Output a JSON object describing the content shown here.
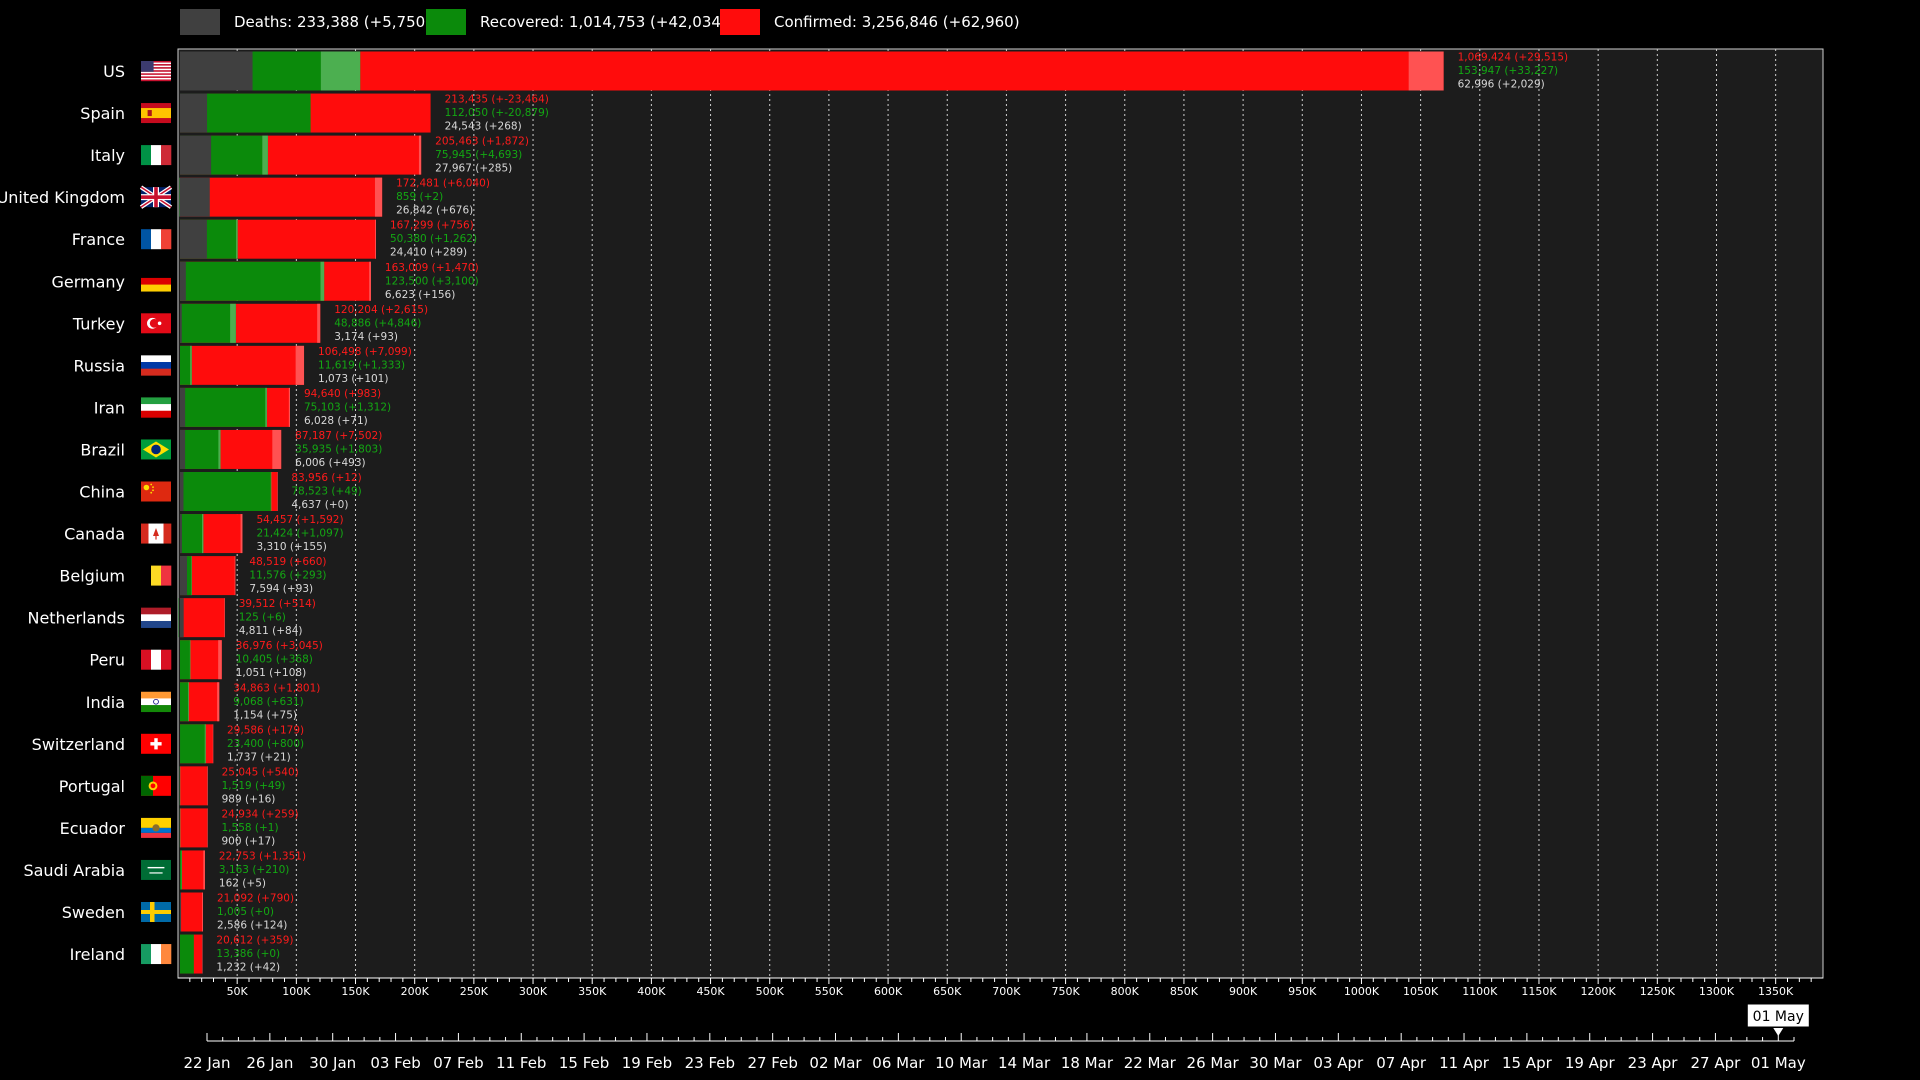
{
  "legend": [
    {
      "key": "deaths",
      "label": "Deaths: 233,388 (+5,750)",
      "color": "#404040"
    },
    {
      "key": "recovered",
      "label": "Recovered: 1,014,753 (+42,034)",
      "color": "#0b8a0b"
    },
    {
      "key": "confirmed",
      "label": "Confirmed: 3,256,846 (+62,960)",
      "color": "#ff0c0c"
    }
  ],
  "colors": {
    "background": "#000000",
    "plot_background": "#1c1c1c",
    "deaths": "#404040",
    "recovered": "#0b8a0b",
    "confirmed": "#ff0c0c",
    "confirmed_increment": "#ff5252",
    "recovered_increment": "#4caf50"
  },
  "chart_data": {
    "type": "bar",
    "orientation": "horizontal",
    "stacked_overlay": true,
    "xlim": [
      0,
      1390000
    ],
    "x_ticks": [
      50000,
      100000,
      150000,
      200000,
      250000,
      300000,
      350000,
      400000,
      450000,
      500000,
      550000,
      600000,
      650000,
      700000,
      750000,
      800000,
      850000,
      900000,
      950000,
      1000000,
      1050000,
      1100000,
      1150000,
      1200000,
      1250000,
      1300000,
      1350000
    ],
    "x_tick_labels": [
      "50K",
      "100K",
      "150K",
      "200K",
      "250K",
      "300K",
      "350K",
      "400K",
      "450K",
      "500K",
      "550K",
      "600K",
      "650K",
      "700K",
      "750K",
      "800K",
      "850K",
      "900K",
      "950K",
      "1000K",
      "1050K",
      "1100K",
      "1150K",
      "1200K",
      "1250K",
      "1300K",
      "1350K"
    ],
    "grid": true,
    "legend_position": "top-left",
    "countries": [
      {
        "name": "US",
        "flag": "us",
        "confirmed": 1069424,
        "confirmed_delta": 29515,
        "recovered": 153947,
        "recovered_delta": 33227,
        "deaths": 62996,
        "deaths_delta": 2029,
        "confirmed_label": "1,069,424 (+29,515)",
        "recovered_label": "153,947 (+33,227)",
        "deaths_label": "62,996 (+2,029)"
      },
      {
        "name": "Spain",
        "flag": "es",
        "confirmed": 213435,
        "confirmed_delta": -23464,
        "recovered": 112050,
        "recovered_delta": -20879,
        "deaths": 24543,
        "deaths_delta": 268,
        "confirmed_label": "213,435 (+-23,464)",
        "recovered_label": "112,050 (+-20,879)",
        "deaths_label": "24,543 (+268)"
      },
      {
        "name": "Italy",
        "flag": "it",
        "confirmed": 205463,
        "confirmed_delta": 1872,
        "recovered": 75945,
        "recovered_delta": 4693,
        "deaths": 27967,
        "deaths_delta": 285,
        "confirmed_label": "205,463 (+1,872)",
        "recovered_label": "75,945 (+4,693)",
        "deaths_label": "27,967 (+285)"
      },
      {
        "name": "United Kingdom",
        "flag": "gb",
        "confirmed": 172481,
        "confirmed_delta": 6040,
        "recovered": 859,
        "recovered_delta": 2,
        "deaths": 26842,
        "deaths_delta": 676,
        "confirmed_label": "172,481 (+6,040)",
        "recovered_label": "859 (+2)",
        "deaths_label": "26,842 (+676)"
      },
      {
        "name": "France",
        "flag": "fr",
        "confirmed": 167299,
        "confirmed_delta": 756,
        "recovered": 50380,
        "recovered_delta": 1262,
        "deaths": 24410,
        "deaths_delta": 289,
        "confirmed_label": "167,299 (+756)",
        "recovered_label": "50,380 (+1,262)",
        "deaths_label": "24,410 (+289)"
      },
      {
        "name": "Germany",
        "flag": "de",
        "confirmed": 163009,
        "confirmed_delta": 1470,
        "recovered": 123500,
        "recovered_delta": 3100,
        "deaths": 6623,
        "deaths_delta": 156,
        "confirmed_label": "163,009 (+1,470)",
        "recovered_label": "123,500 (+3,100)",
        "deaths_label": "6,623 (+156)"
      },
      {
        "name": "Turkey",
        "flag": "tr",
        "confirmed": 120204,
        "confirmed_delta": 2615,
        "recovered": 48886,
        "recovered_delta": 4846,
        "deaths": 3174,
        "deaths_delta": 93,
        "confirmed_label": "120,204 (+2,615)",
        "recovered_label": "48,886 (+4,846)",
        "deaths_label": "3,174 (+93)"
      },
      {
        "name": "Russia",
        "flag": "ru",
        "confirmed": 106498,
        "confirmed_delta": 7099,
        "recovered": 11619,
        "recovered_delta": 1333,
        "deaths": 1073,
        "deaths_delta": 101,
        "confirmed_label": "106,498 (+7,099)",
        "recovered_label": "11,619 (+1,333)",
        "deaths_label": "1,073 (+101)"
      },
      {
        "name": "Iran",
        "flag": "ir",
        "confirmed": 94640,
        "confirmed_delta": 983,
        "recovered": 75103,
        "recovered_delta": 1312,
        "deaths": 6028,
        "deaths_delta": 71,
        "confirmed_label": "94,640 (+983)",
        "recovered_label": "75,103 (+1,312)",
        "deaths_label": "6,028 (+71)"
      },
      {
        "name": "Brazil",
        "flag": "br",
        "confirmed": 87187,
        "confirmed_delta": 7502,
        "recovered": 35935,
        "recovered_delta": 1803,
        "deaths": 6006,
        "deaths_delta": 493,
        "confirmed_label": "87,187 (+7,502)",
        "recovered_label": "35,935 (+1,803)",
        "deaths_label": "6,006 (+493)"
      },
      {
        "name": "China",
        "flag": "cn",
        "confirmed": 83956,
        "confirmed_delta": 12,
        "recovered": 78523,
        "recovered_delta": 49,
        "deaths": 4637,
        "deaths_delta": 0,
        "confirmed_label": "83,956 (+12)",
        "recovered_label": "78,523 (+49)",
        "deaths_label": "4,637 (+0)"
      },
      {
        "name": "Canada",
        "flag": "ca",
        "confirmed": 54457,
        "confirmed_delta": 1592,
        "recovered": 21424,
        "recovered_delta": 1097,
        "deaths": 3310,
        "deaths_delta": 155,
        "confirmed_label": "54,457 (+1,592)",
        "recovered_label": "21,424 (+1,097)",
        "deaths_label": "3,310 (+155)"
      },
      {
        "name": "Belgium",
        "flag": "be",
        "confirmed": 48519,
        "confirmed_delta": 660,
        "recovered": 11576,
        "recovered_delta": 293,
        "deaths": 7594,
        "deaths_delta": 93,
        "confirmed_label": "48,519 (+660)",
        "recovered_label": "11,576 (+293)",
        "deaths_label": "7,594 (+93)"
      },
      {
        "name": "Netherlands",
        "flag": "nl",
        "confirmed": 39512,
        "confirmed_delta": 514,
        "recovered": 125,
        "recovered_delta": 6,
        "deaths": 4811,
        "deaths_delta": 84,
        "confirmed_label": "39,512 (+514)",
        "recovered_label": "125 (+6)",
        "deaths_label": "4,811 (+84)"
      },
      {
        "name": "Peru",
        "flag": "pe",
        "confirmed": 36976,
        "confirmed_delta": 3045,
        "recovered": 10405,
        "recovered_delta": 368,
        "deaths": 1051,
        "deaths_delta": 108,
        "confirmed_label": "36,976 (+3,045)",
        "recovered_label": "10,405 (+368)",
        "deaths_label": "1,051 (+108)"
      },
      {
        "name": "India",
        "flag": "in",
        "confirmed": 34863,
        "confirmed_delta": 1801,
        "recovered": 9068,
        "recovered_delta": 631,
        "deaths": 1154,
        "deaths_delta": 75,
        "confirmed_label": "34,863 (+1,801)",
        "recovered_label": "9,068 (+631)",
        "deaths_label": "1,154 (+75)"
      },
      {
        "name": "Switzerland",
        "flag": "ch",
        "confirmed": 29586,
        "confirmed_delta": 179,
        "recovered": 23400,
        "recovered_delta": 800,
        "deaths": 1737,
        "deaths_delta": 21,
        "confirmed_label": "29,586 (+179)",
        "recovered_label": "23,400 (+800)",
        "deaths_label": "1,737 (+21)"
      },
      {
        "name": "Portugal",
        "flag": "pt",
        "confirmed": 25045,
        "confirmed_delta": 540,
        "recovered": 1519,
        "recovered_delta": 49,
        "deaths": 989,
        "deaths_delta": 16,
        "confirmed_label": "25,045 (+540)",
        "recovered_label": "1,519 (+49)",
        "deaths_label": "989 (+16)"
      },
      {
        "name": "Ecuador",
        "flag": "ec",
        "confirmed": 24934,
        "confirmed_delta": 259,
        "recovered": 1558,
        "recovered_delta": 1,
        "deaths": 900,
        "deaths_delta": 17,
        "confirmed_label": "24,934 (+259)",
        "recovered_label": "1,558 (+1)",
        "deaths_label": "900 (+17)"
      },
      {
        "name": "Saudi Arabia",
        "flag": "sa",
        "confirmed": 22753,
        "confirmed_delta": 1351,
        "recovered": 3163,
        "recovered_delta": 210,
        "deaths": 162,
        "deaths_delta": 5,
        "confirmed_label": "22,753 (+1,351)",
        "recovered_label": "3,163 (+210)",
        "deaths_label": "162 (+5)"
      },
      {
        "name": "Sweden",
        "flag": "se",
        "confirmed": 21092,
        "confirmed_delta": 790,
        "recovered": 1005,
        "recovered_delta": 0,
        "deaths": 2586,
        "deaths_delta": 124,
        "confirmed_label": "21,092 (+790)",
        "recovered_label": "1,005 (+0)",
        "deaths_label": "2,586 (+124)"
      },
      {
        "name": "Ireland",
        "flag": "ie",
        "confirmed": 20612,
        "confirmed_delta": 359,
        "recovered": 13386,
        "recovered_delta": 0,
        "deaths": 1232,
        "deaths_delta": 42,
        "confirmed_label": "20,612 (+359)",
        "recovered_label": "13,386 (+0)",
        "deaths_label": "1,232 (+42)"
      }
    ]
  },
  "timeline": {
    "labels": [
      "22 Jan",
      "26 Jan",
      "30 Jan",
      "03 Feb",
      "07 Feb",
      "11 Feb",
      "15 Feb",
      "19 Feb",
      "23 Feb",
      "27 Feb",
      "02 Mar",
      "06 Mar",
      "10 Mar",
      "14 Mar",
      "18 Mar",
      "22 Mar",
      "26 Mar",
      "30 Mar",
      "03 Apr",
      "07 Apr",
      "11 Apr",
      "15 Apr",
      "19 Apr",
      "23 Apr",
      "27 Apr",
      "01 May"
    ],
    "days_total": 101,
    "current_day": 100,
    "current_label": "01 May"
  }
}
